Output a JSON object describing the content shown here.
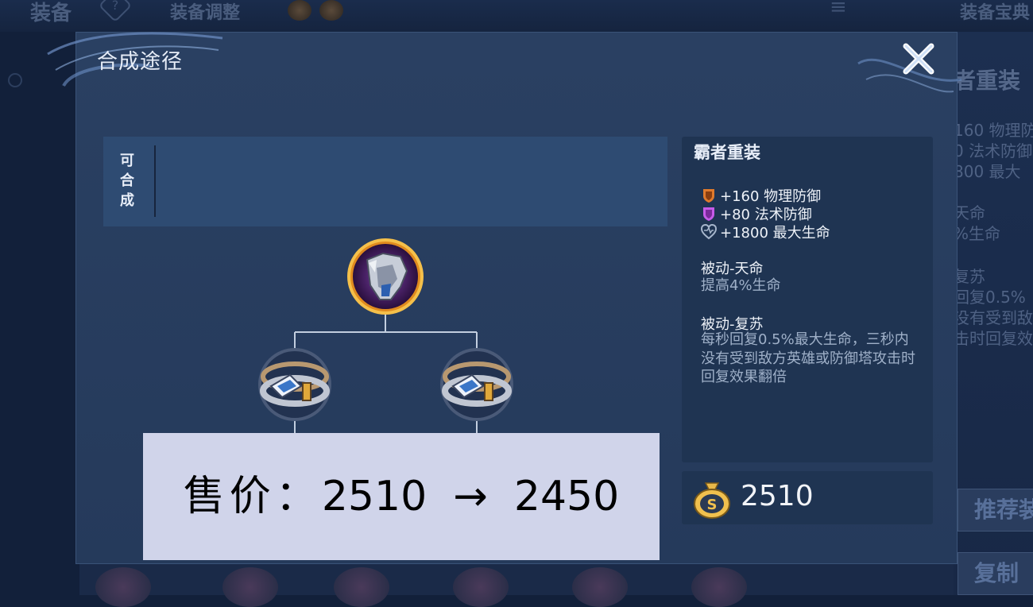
{
  "background": {
    "tabs": [
      "装备",
      "装备调整"
    ],
    "help_icon": "?",
    "menu_icon": "≡",
    "top_right_tab": "装备宝典",
    "right_title": "者重装",
    "right_stats": [
      "160 物理防",
      "0 法术防御",
      "800 最大",
      "天命",
      "%生命",
      "复苏",
      "回复0.5%",
      "没有受到敌",
      "击时回复效"
    ],
    "right_buttons": [
      "推荐装",
      "复制"
    ]
  },
  "modal": {
    "title": "合成途径",
    "close_icon": "close-x-icon",
    "recipe_label": [
      "可",
      "合",
      "成"
    ],
    "tree": {
      "root_item": "霸者重装",
      "children": [
        "component-a",
        "component-b"
      ]
    },
    "info": {
      "name": "霸者重装",
      "stats": [
        {
          "icon": "physical-defense-icon",
          "text": "+160 物理防御",
          "color": "#e07a2c"
        },
        {
          "icon": "magic-defense-icon",
          "text": "+80 法术防御",
          "color": "#b446d8"
        },
        {
          "icon": "max-hp-icon",
          "text": "+1800 最大生命",
          "color": "#8fa2bd"
        }
      ],
      "passives": [
        {
          "title": "被动-天命",
          "desc": "提高4%生命"
        },
        {
          "title": "被动-复苏",
          "desc": "每秒回复0.5%最大生命，三秒内没有受到敌方英雄或防御塔攻击时回复效果翻倍"
        }
      ]
    },
    "price": "2510"
  },
  "overlay": {
    "label": "售价：",
    "old_price": "2510",
    "arrow": "→",
    "new_price": "2450"
  }
}
